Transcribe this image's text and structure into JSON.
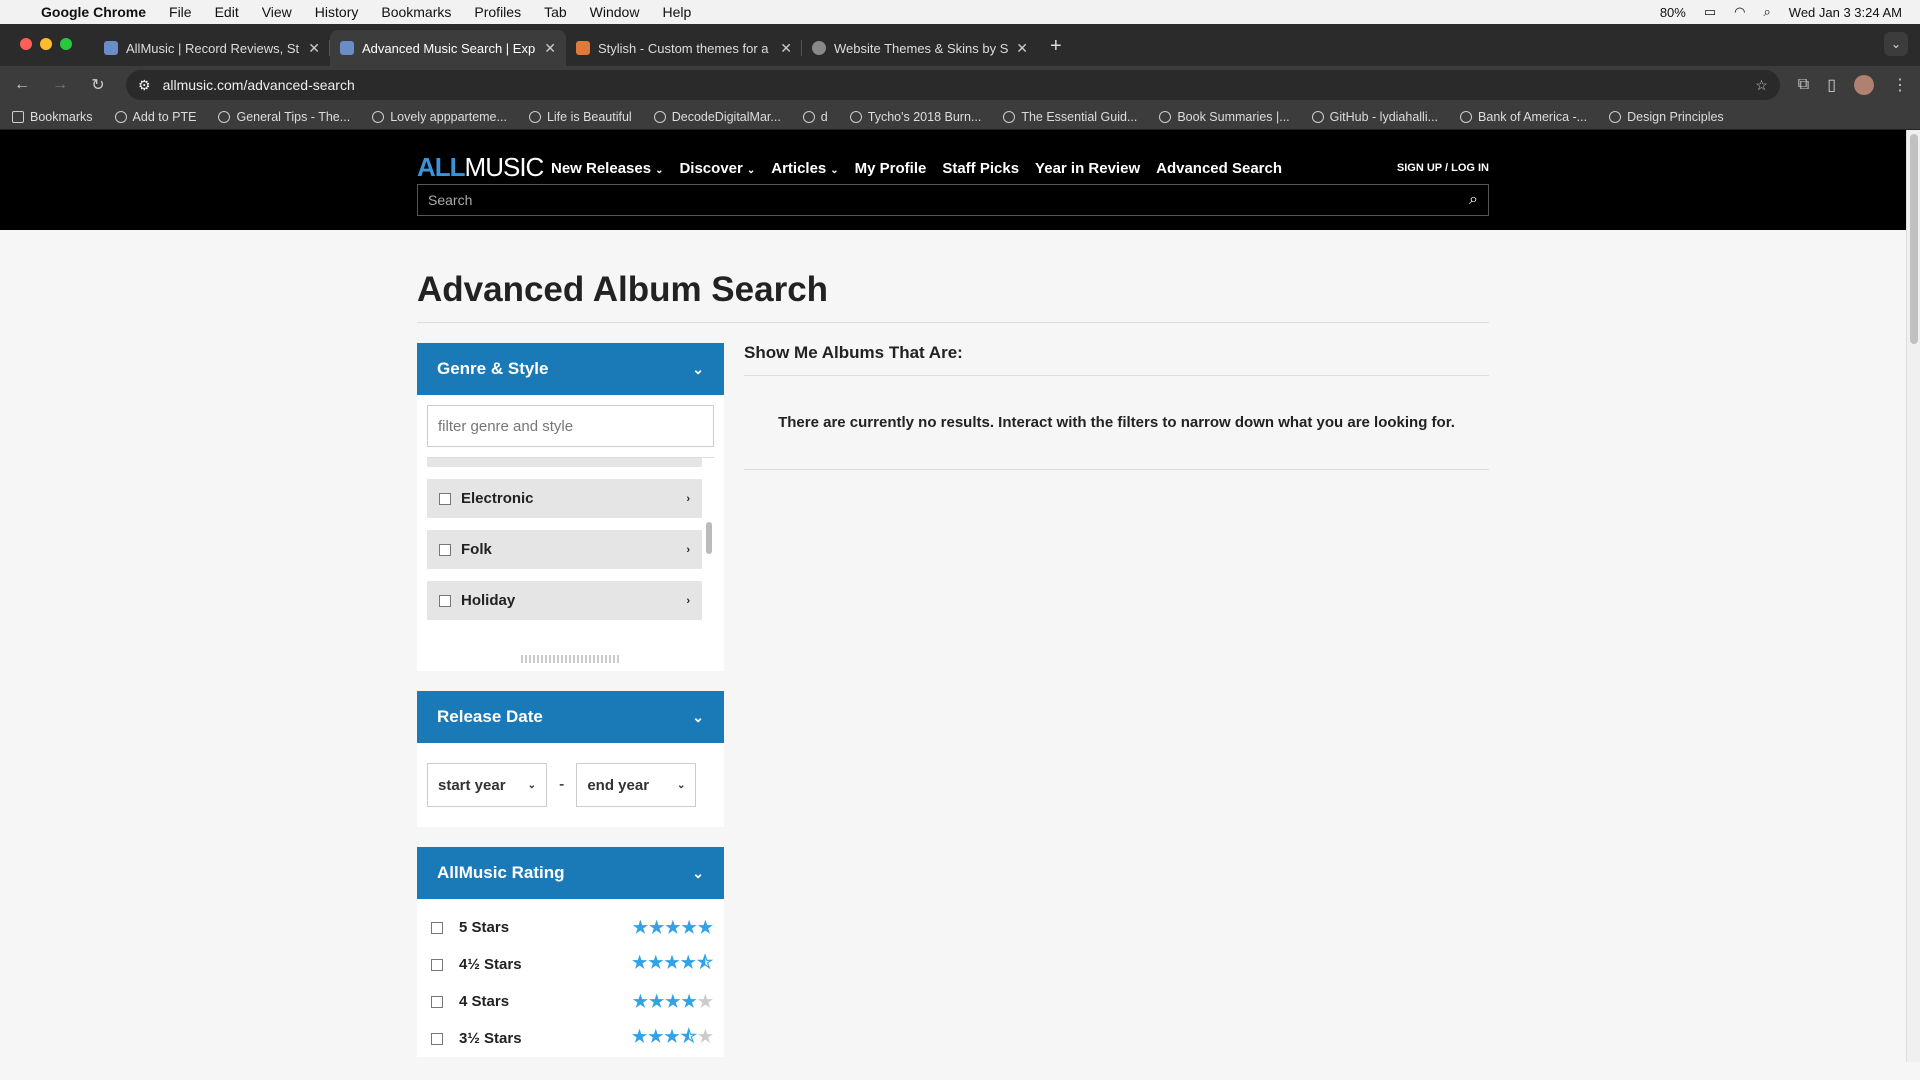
{
  "menubar": {
    "app": "Google Chrome",
    "items": [
      "File",
      "Edit",
      "View",
      "History",
      "Bookmarks",
      "Profiles",
      "Tab",
      "Window",
      "Help"
    ],
    "battery": "80%",
    "datetime": "Wed Jan 3  3:24 AM"
  },
  "tabs": [
    {
      "title": "AllMusic | Record Reviews, St",
      "active": false
    },
    {
      "title": "Advanced Music Search | Exp",
      "active": true
    },
    {
      "title": "Stylish - Custom themes for a",
      "active": false
    },
    {
      "title": "Website Themes & Skins by S",
      "active": false
    }
  ],
  "omnibox": {
    "url": "allmusic.com/advanced-search"
  },
  "bookmarks": [
    "Bookmarks",
    "Add to PTE",
    "General Tips - The...",
    "Lovely appparteme...",
    "Life is Beautiful",
    "DecodeDigitalMar...",
    "d",
    "Tycho's 2018 Burn...",
    "The Essential Guid...",
    "Book Summaries |...",
    "GitHub - lydiahalli...",
    "Bank of America -...",
    "Design Principles"
  ],
  "site": {
    "logo_all": "ALL",
    "logo_music": "MUSIC",
    "nav": [
      {
        "label": "New Releases",
        "dropdown": true
      },
      {
        "label": "Discover",
        "dropdown": true
      },
      {
        "label": "Articles",
        "dropdown": true
      },
      {
        "label": "My Profile",
        "dropdown": false
      },
      {
        "label": "Staff Picks",
        "dropdown": false
      },
      {
        "label": "Year in Review",
        "dropdown": false
      },
      {
        "label": "Advanced Search",
        "dropdown": false
      }
    ],
    "signup": "SIGN UP / LOG IN",
    "search_placeholder": "Search"
  },
  "page": {
    "title": "Advanced Album Search",
    "genre_panel": {
      "title": "Genre & Style",
      "filter_placeholder": "filter genre and style",
      "items": [
        "Electronic",
        "Folk",
        "Holiday"
      ]
    },
    "release_panel": {
      "title": "Release Date",
      "start": "start year",
      "dash": "-",
      "end": "end year"
    },
    "rating_panel": {
      "title": "AllMusic Rating",
      "rows": [
        {
          "label": "5 Stars",
          "stars": 5
        },
        {
          "label": "4½ Stars",
          "stars": 4.5
        },
        {
          "label": "4 Stars",
          "stars": 4
        },
        {
          "label": "3½ Stars",
          "stars": 3.5
        }
      ]
    },
    "results_title": "Show Me Albums That Are:",
    "no_results": "There are currently no results. Interact with the filters to narrow down what you are looking for."
  },
  "colors": {
    "accent": "#1a7ab7",
    "star": "#2fa3e5",
    "logo_all": "#3b93d9"
  }
}
